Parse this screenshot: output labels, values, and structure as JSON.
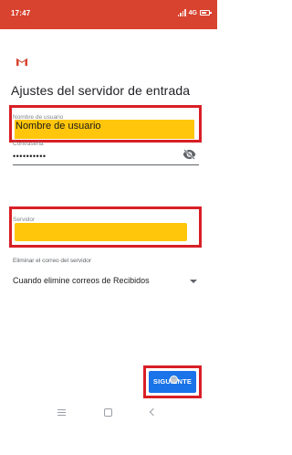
{
  "status_bar": {
    "time": "17:47",
    "network": "4G",
    "background_color": "#d8432f"
  },
  "app": {
    "logo_icon": "gmail-m-icon",
    "title": "Ajustes del servidor de entrada"
  },
  "fields": {
    "username": {
      "label": "Nombre de usuario",
      "value": "Nombre de usuario",
      "highlight_color": "#ffc60b"
    },
    "password": {
      "label": "Contraseña",
      "value": "••••••••••",
      "toggle_icon": "visibility-off-icon"
    },
    "server": {
      "label": "Servidor",
      "value": ""
    }
  },
  "delete_policy": {
    "label": "Eliminar el correo del servidor",
    "selected": "Cuando elimine correos de Recibidos"
  },
  "next_button": {
    "label": "SIGUIENTE",
    "color": "#1a73e8"
  },
  "annotation_color": "#d81f26",
  "nav_bar": {
    "icons": [
      "menu-icon",
      "home-icon",
      "back-icon"
    ]
  }
}
